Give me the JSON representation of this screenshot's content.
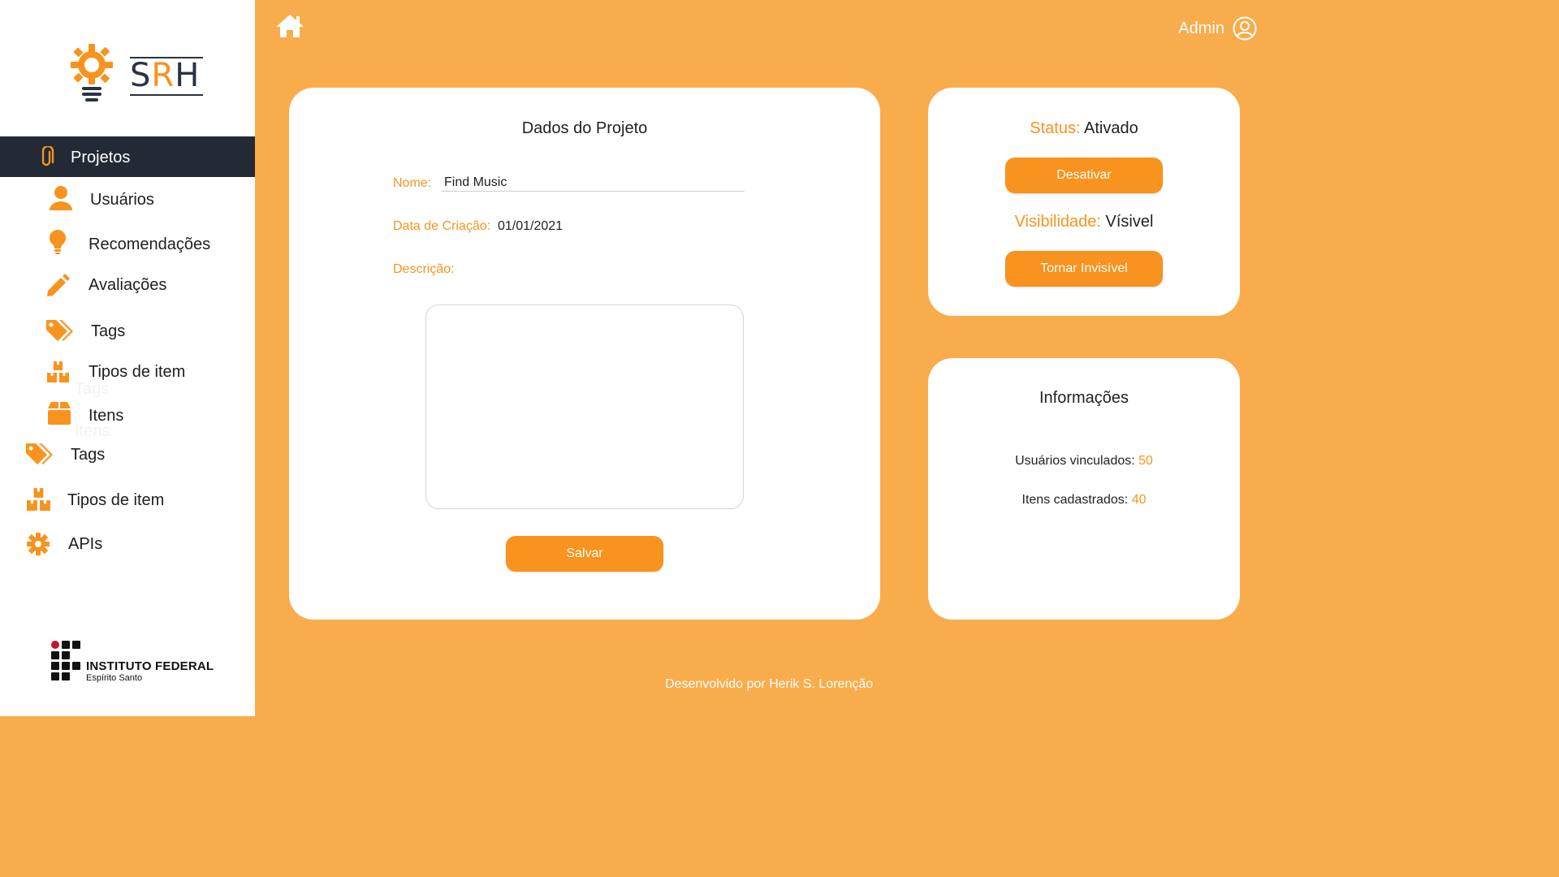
{
  "brand": {
    "logo_text_s": "S",
    "logo_text_r": "R",
    "logo_text_h": "H"
  },
  "sidebar": {
    "active": {
      "label": "Projetos",
      "icon": "paperclip-icon"
    },
    "items": [
      {
        "label": "Usuários",
        "icon": "user-icon"
      },
      {
        "label": "Recomendações",
        "icon": "lightbulb-icon"
      },
      {
        "label": "Avaliações",
        "icon": "pencil-icon"
      },
      {
        "label": "Tags",
        "icon": "tag-icon"
      },
      {
        "label": "Tipos de item",
        "icon": "boxes-icon"
      },
      {
        "label": "Itens",
        "icon": "box-icon"
      },
      {
        "label": "Tags",
        "icon": "tag-icon"
      },
      {
        "label": "Tipos de item",
        "icon": "boxes-icon"
      },
      {
        "label": "APIs",
        "icon": "gear-icon"
      }
    ],
    "ghost": {
      "a": "Tags",
      "b": "Itens"
    },
    "institution": {
      "name": "INSTITUTO FEDERAL",
      "sub": "Espírito Santo"
    }
  },
  "header": {
    "user": "Admin"
  },
  "project": {
    "title": "Dados do Projeto",
    "name_label": "Nome:",
    "name_value": "Find Music",
    "date_label": "Data de Criação:",
    "date_value": "01/01/2021",
    "desc_label": "Descrição:",
    "desc_value": "",
    "save_label": "Salvar"
  },
  "status": {
    "status_label": "Status:",
    "status_value": "Ativado",
    "deactivate_label": "Desativar",
    "visibility_label": "Visibilidade:",
    "visibility_value": "Vísivel",
    "make_invisible_label": "Tornar Invisível"
  },
  "info": {
    "title": "Informações",
    "users_label": "Usuários vinculados:",
    "users_value": "50",
    "items_label": "Itens cadastrados:",
    "items_value": "40"
  },
  "footer": {
    "text": "Desenvolvido por Herik S. Lorenção"
  },
  "colors": {
    "accent": "#F7931E",
    "background": "#F9AC4C",
    "sidebar_active": "#232a35"
  }
}
